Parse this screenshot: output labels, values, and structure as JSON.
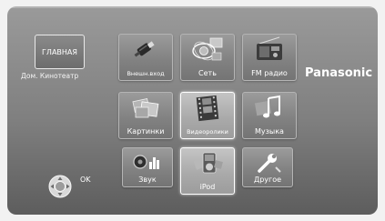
{
  "home": {
    "button_label": "ГЛАВНАЯ",
    "subtitle": "Дом. Кинотеатр"
  },
  "brand": "Panasonic",
  "menu": {
    "external_input": "Внешн.вход",
    "network": "Сеть",
    "fm_radio": "FM радио",
    "pictures": "Картинки",
    "videos": "Видеоролики",
    "music": "Музыка",
    "sound": "Звук",
    "ipod": "iPod",
    "other": "Другое"
  },
  "nav_hint": {
    "ok_label": "OK",
    "icon": "dpad-icon"
  },
  "colors": {
    "background": "#7f7f7f",
    "tile": "#8a8a8a",
    "text": "#ffffff"
  }
}
